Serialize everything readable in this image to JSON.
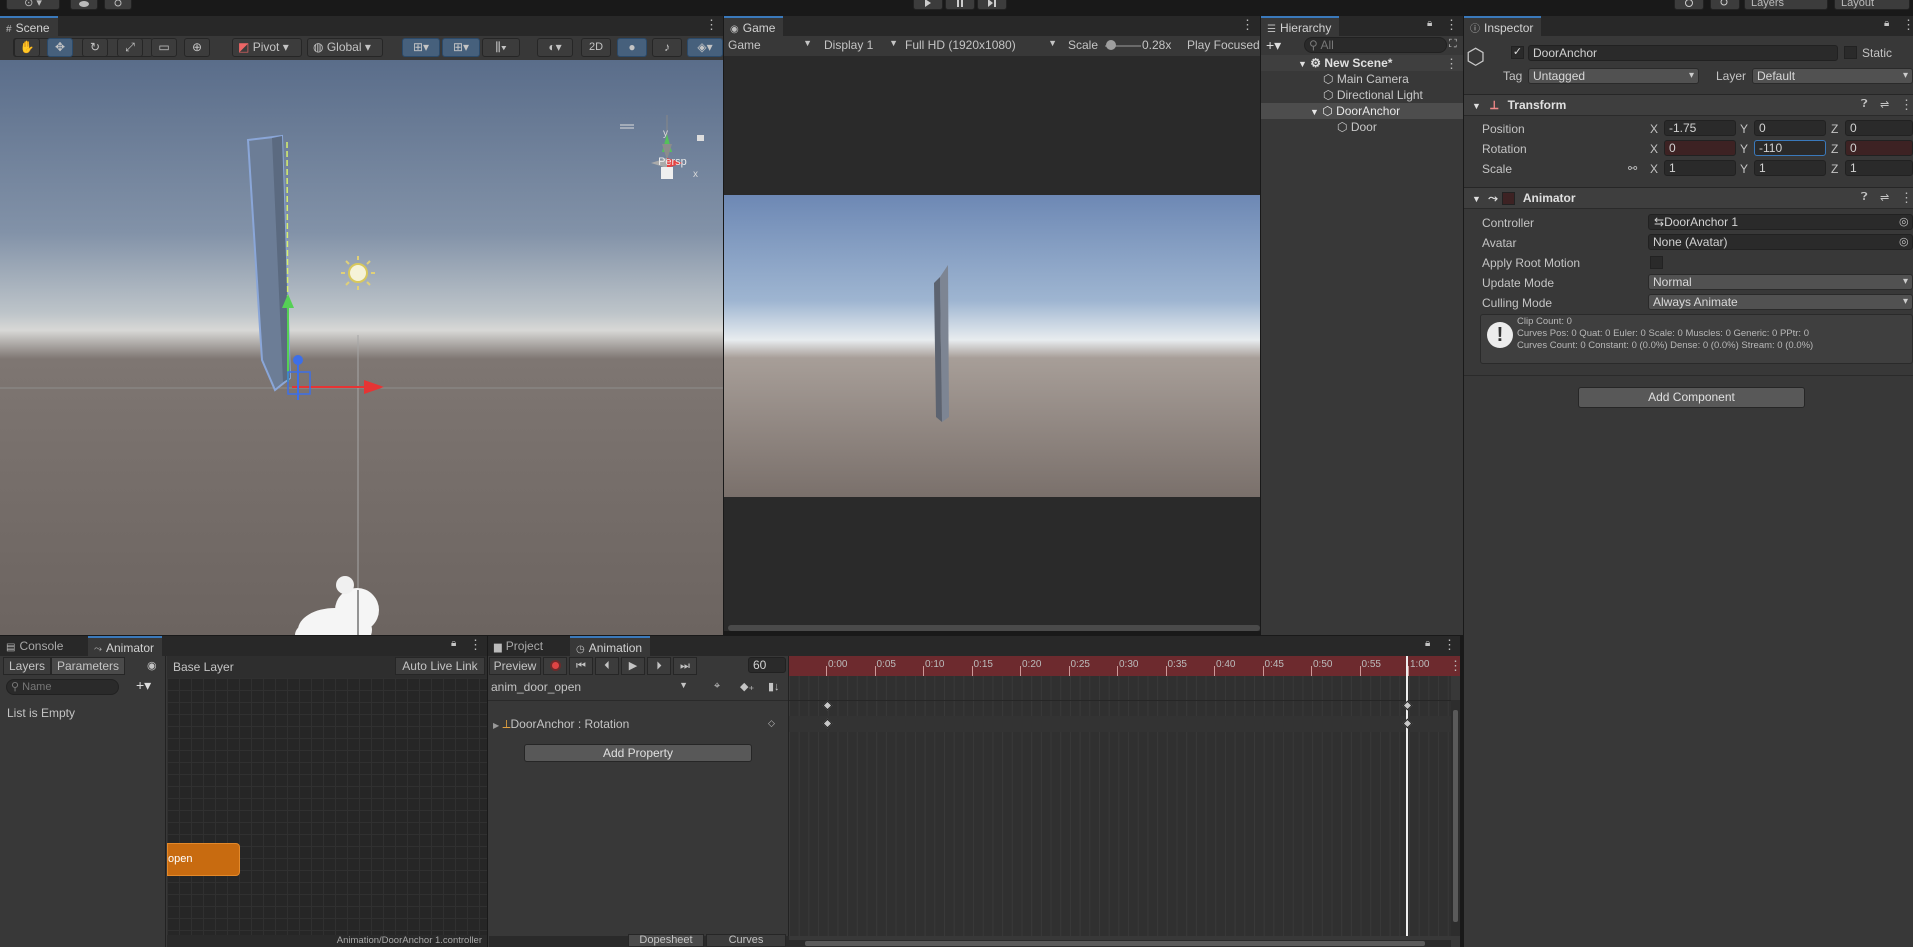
{
  "topbar": {
    "left_buttons": [
      "⊙ ▾"
    ],
    "right_menus": [
      "Layers",
      "Layout"
    ]
  },
  "scene": {
    "tab": "Scene",
    "pivot": "Pivot",
    "global": "Global",
    "mode_2d": "2D",
    "persp": "Persp",
    "gizmo_axes": {
      "x": "x",
      "y": "y"
    }
  },
  "game": {
    "tab": "Game",
    "mode": "Game",
    "display": "Display 1",
    "resolution": "Full HD (1920x1080)",
    "scale_label": "Scale",
    "scale_value": "0.28x",
    "play_mode": "Play Focused"
  },
  "hierarchy": {
    "tab": "Hierarchy",
    "search_placeholder": "All",
    "scene_name": "New Scene*",
    "items": [
      {
        "label": "Main Camera"
      },
      {
        "label": "Directional Light"
      },
      {
        "label": "DoorAnchor"
      },
      {
        "label": "Door"
      }
    ]
  },
  "inspector": {
    "tab": "Inspector",
    "object_name": "DoorAnchor",
    "static_label": "Static",
    "tag_label": "Tag",
    "tag_value": "Untagged",
    "layer_label": "Layer",
    "layer_value": "Default",
    "transform": {
      "title": "Transform",
      "position_label": "Position",
      "rotation_label": "Rotation",
      "scale_label": "Scale",
      "axis_x": "X",
      "axis_y": "Y",
      "axis_z": "Z",
      "position": {
        "x": "-1.75",
        "y": "0",
        "z": "0"
      },
      "rotation": {
        "x": "0",
        "y": "-110",
        "z": "0"
      },
      "scale": {
        "x": "1",
        "y": "1",
        "z": "1"
      }
    },
    "animator": {
      "title": "Animator",
      "controller_label": "Controller",
      "controller_value": "DoorAnchor 1",
      "avatar_label": "Avatar",
      "avatar_value": "None (Avatar)",
      "apply_root_label": "Apply Root Motion",
      "update_mode_label": "Update Mode",
      "update_mode_value": "Normal",
      "culling_mode_label": "Culling Mode",
      "culling_mode_value": "Always Animate",
      "info_lines": [
        "Clip Count: 0",
        "Curves Pos: 0 Quat: 0 Euler: 0 Scale: 0 Muscles: 0 Generic: 0 PPtr: 0",
        "Curves Count: 0 Constant: 0 (0.0%) Dense: 0 (0.0%) Stream: 0 (0.0%)"
      ]
    },
    "add_component": "Add Component"
  },
  "animator_window": {
    "console_tab": "Console",
    "animator_tab": "Animator",
    "layers_tab": "Layers",
    "parameters_tab": "Parameters",
    "name_placeholder": "Name",
    "list_empty": "List is Empty",
    "base_layer": "Base Layer",
    "auto_live_link": "Auto Live Link",
    "state_label": "open",
    "footer_path": "Animation/DoorAnchor 1.controller"
  },
  "animation_window": {
    "project_tab": "Project",
    "animation_tab": "Animation",
    "preview": "Preview",
    "frame": "60",
    "clip": "anim_door_open",
    "property": "DoorAnchor : Rotation",
    "add_property": "Add Property",
    "dopesheet": "Dopesheet",
    "curves": "Curves",
    "ticks": [
      "0:00",
      "0:05",
      "0:10",
      "0:15",
      "0:20",
      "0:25",
      "0:30",
      "0:35",
      "0:40",
      "0:45",
      "0:50",
      "0:55",
      "1:00"
    ]
  }
}
